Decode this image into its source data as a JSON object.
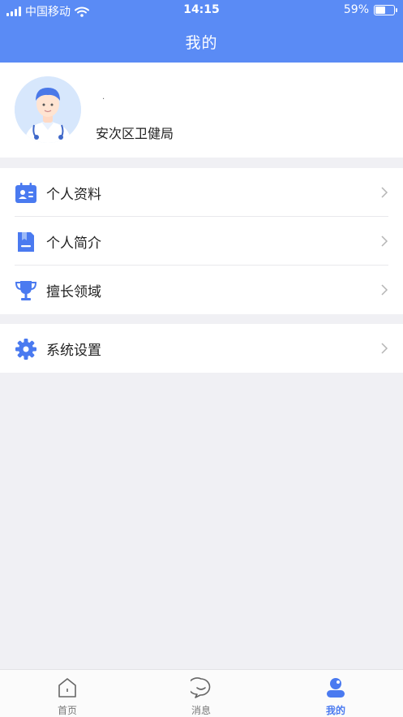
{
  "status_bar": {
    "carrier": "中国移动",
    "time": "14:15",
    "battery": "59%",
    "battery_level": 0.59
  },
  "header": {
    "title": "我的"
  },
  "profile": {
    "name": "·",
    "organization": "安次区卫健局",
    "avatar_icon": "doctor-avatar-icon"
  },
  "menu": {
    "group1": [
      {
        "label": "个人资料",
        "icon": "id-card-icon"
      },
      {
        "label": "个人简介",
        "icon": "book-icon"
      },
      {
        "label": "擅长领域",
        "icon": "trophy-icon"
      }
    ],
    "group2": [
      {
        "label": "系统设置",
        "icon": "gear-icon"
      }
    ]
  },
  "tabbar": {
    "tabs": [
      {
        "label": "首页",
        "icon": "home-icon",
        "active": false
      },
      {
        "label": "消息",
        "icon": "message-icon",
        "active": false
      },
      {
        "label": "我的",
        "icon": "profile-icon",
        "active": true
      }
    ]
  },
  "colors": {
    "primary": "#5a8bf5",
    "icon_blue": "#4a7af0",
    "background": "#f0f0f4"
  }
}
